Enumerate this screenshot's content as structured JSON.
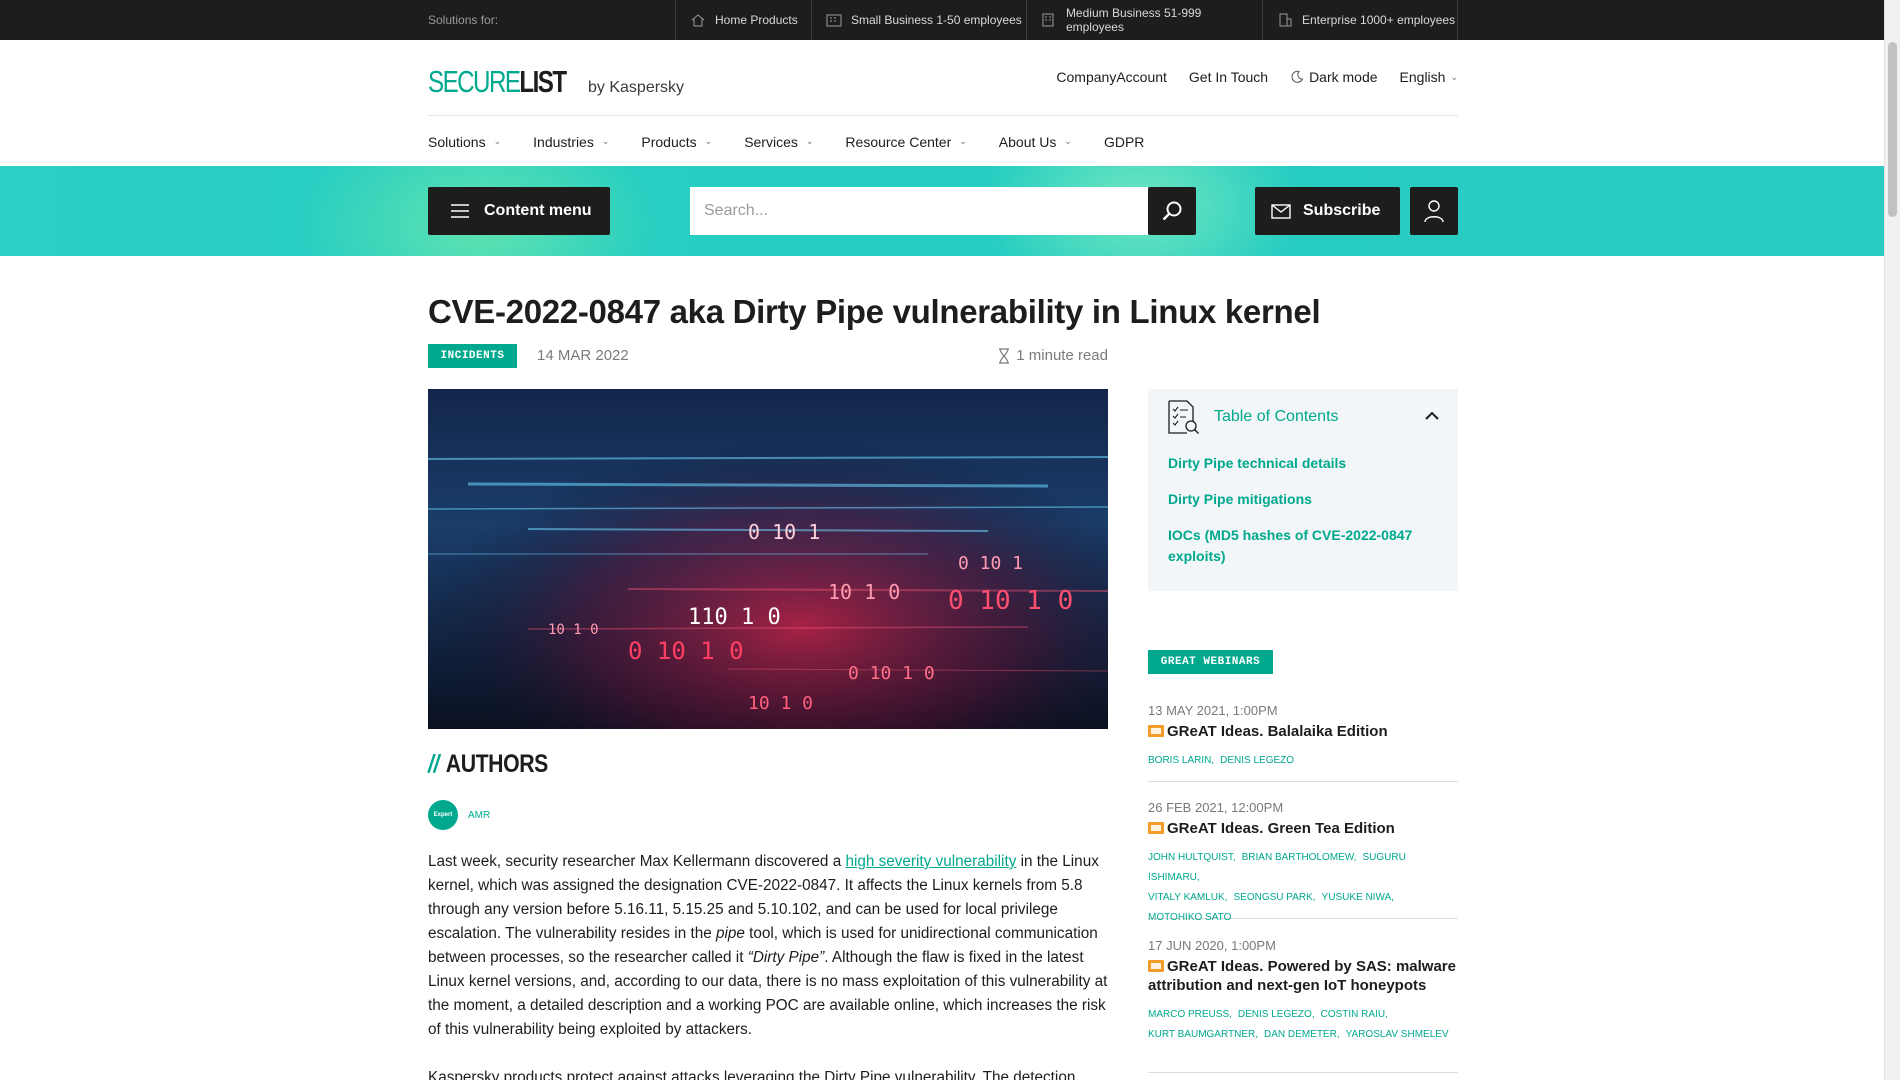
{
  "topbar": {
    "solutions_label": "Solutions for:",
    "segments": [
      {
        "label": "Home Products",
        "icon": "home-icon"
      },
      {
        "label": "Small Business 1-50 employees",
        "icon": "building-icon"
      },
      {
        "label": "Medium Business 51-999 employees",
        "icon": "building-icon"
      },
      {
        "label": "Enterprise 1000+ employees",
        "icon": "enterprise-icon"
      }
    ]
  },
  "header": {
    "logo_secure": "SECURE",
    "logo_list": "LIST",
    "logo_by": "by Kaspersky",
    "links": {
      "company_account": "CompanyAccount",
      "get_in_touch": "Get In Touch",
      "dark_mode": "Dark mode",
      "language": "English"
    }
  },
  "nav": {
    "items": [
      {
        "label": "Solutions",
        "dropdown": true
      },
      {
        "label": "Industries",
        "dropdown": true
      },
      {
        "label": "Products",
        "dropdown": true
      },
      {
        "label": "Services",
        "dropdown": true
      },
      {
        "label": "Resource Center",
        "dropdown": true
      },
      {
        "label": "About Us",
        "dropdown": true
      },
      {
        "label": "GDPR",
        "dropdown": false
      }
    ]
  },
  "band": {
    "content_menu": "Content menu",
    "search_placeholder": "Search...",
    "subscribe": "Subscribe"
  },
  "article": {
    "title": "CVE-2022-0847 aka Dirty Pipe vulnerability in Linux kernel",
    "category": "INCIDENTS",
    "date": "14 MAR 2022",
    "read_time": "1 minute read",
    "authors_heading": "AUTHORS",
    "authors_slashes": "//",
    "author_badge": "Expert",
    "author_name": "AMR",
    "p1_before_link": "Last week, security researcher Max Kellermann discovered a ",
    "p1_link": "high severity vulnerability",
    "p1_after_link": " in the Linux kernel, which was assigned the designation CVE-2022-0847. It affects the Linux kernels from 5.8 through any version before 5.16.11, 5.15.25 and 5.10.102, and can be used for local privilege escalation. The vulnerability resides in the ",
    "p1_italic_pipe": "pipe",
    "p1_mid": " tool, which is used for unidirectional communication between processes, so the researcher called it ",
    "p1_italic_dirty": "“Dirty Pipe”",
    "p1_end": ". Although the flaw is fixed in the latest Linux kernel versions, and, according to our data, there is no mass exploitation of this vulnerability at the moment, a detailed description and a working POC are available online, which increases the risk of this vulnerability being exploited by attackers.",
    "p2": "Kaspersky products protect against attacks leveraging the Dirty Pipe vulnerability. The detection"
  },
  "toc": {
    "title": "Table of Contents",
    "items": [
      "Dirty Pipe technical details",
      "Dirty Pipe mitigations",
      "IOCs (MD5 hashes of CVE-2022-0847 exploits)"
    ]
  },
  "webinars": {
    "tag": "GREAT WEBINARS",
    "items": [
      {
        "date": "13 MAY 2021, 1:00PM",
        "title": "GReAT Ideas. Balalaika Edition",
        "authors": [
          "BORIS LARIN,",
          "DENIS LEGEZO"
        ]
      },
      {
        "date": "26 FEB 2021, 12:00PM",
        "title": "GReAT Ideas. Green Tea Edition",
        "authors": [
          "JOHN HULTQUIST,",
          "BRIAN BARTHOLOMEW,",
          "SUGURU ISHIMARU,",
          "VITALY KAMLUK,",
          "SEONGSU PARK,",
          "YUSUKE NIWA,",
          "MOTOHIKO SATO"
        ]
      },
      {
        "date": "17 JUN 2020, 1:00PM",
        "title": "GReAT Ideas. Powered by SAS: malware attribution and next-gen IoT honeypots",
        "authors": [
          "MARCO PREUSS,",
          "DENIS LEGEZO,",
          "COSTIN RAIU,",
          "KURT BAUMGARTNER,",
          "DAN DEMETER,",
          "YAROSLAV SHMELEV"
        ]
      }
    ]
  },
  "hero_digits": [
    "0 10 1",
    "10 1 0",
    "0 10 1 0",
    "110 1 0",
    "10 1 0",
    "0 10 1 0",
    "0 10 1",
    "0 10 1 0",
    "10 1 0"
  ],
  "colors": {
    "accent": "#00a88e",
    "dark": "#1d1d1b",
    "band": "#25cdc1",
    "toc_bg": "#f2f6f8"
  }
}
